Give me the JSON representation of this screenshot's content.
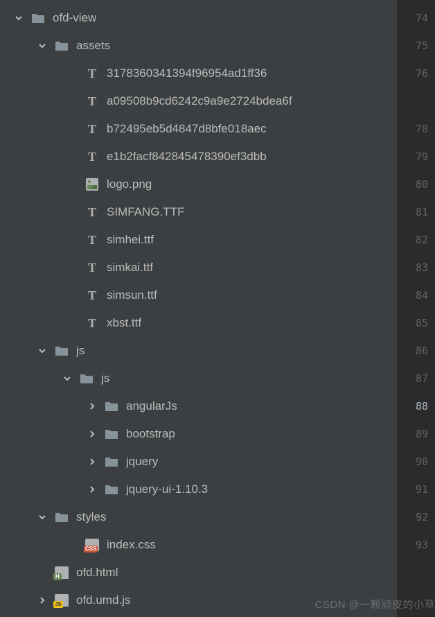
{
  "tree": {
    "root": "ofd-view",
    "assets": {
      "name": "assets",
      "files": [
        "3178360341394f96954ad1ff36",
        "a09508b9cd6242c9a9e2724bdea6f",
        "b72495eb5d4847d8bfe018aec",
        "e1b2facf842845478390ef3dbb",
        "logo.png",
        "SIMFANG.TTF",
        "simhei.ttf",
        "simkai.ttf",
        "simsun.ttf",
        "xbst.ttf"
      ]
    },
    "js": {
      "name": "js",
      "inner": {
        "name": "js",
        "folders": [
          "angularJs",
          "bootstrap",
          "jquery",
          "jquery-ui-1.10.3"
        ]
      }
    },
    "styles": {
      "name": "styles",
      "files": [
        "index.css"
      ]
    },
    "rootFiles": [
      "ofd.html",
      "ofd.umd.js"
    ]
  },
  "gutter": [
    "74",
    "75",
    "76",
    "",
    "78",
    "79",
    "80",
    "81",
    "82",
    "83",
    "84",
    "85",
    "86",
    "87",
    "88",
    "89",
    "90",
    "91",
    "92",
    "93",
    ""
  ],
  "gutterSelectedIndex": 14,
  "watermark": "CSDN @一颗顽皮的小草"
}
